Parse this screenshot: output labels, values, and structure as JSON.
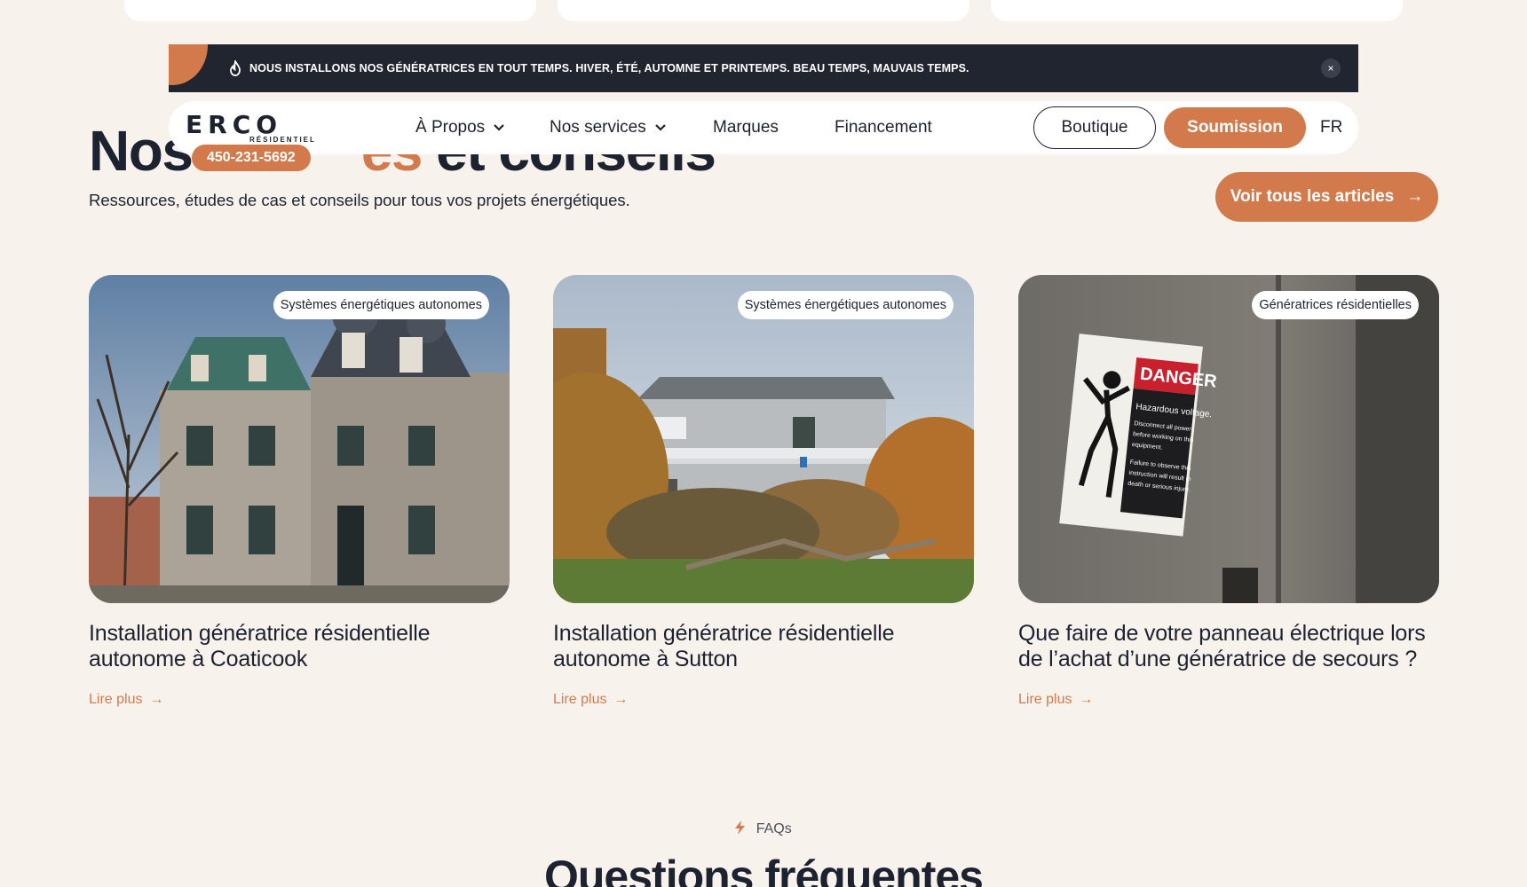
{
  "banner": {
    "text": "NOUS INSTALLONS NOS GÉNÉRATRICES EN TOUT TEMPS. HIVER, ÉTÉ, AUTOMNE ET PRINTEMPS. BEAU TEMPS, MAUVAIS TEMPS.",
    "icon": "flame-icon",
    "close_icon": "×"
  },
  "navbar": {
    "logo_main": "ERCO",
    "logo_sub": "RÉSIDENTIEL",
    "phone": "450-231-5692",
    "items": [
      {
        "label": "À Propos",
        "dropdown": true
      },
      {
        "label": "Nos services",
        "dropdown": true
      },
      {
        "label": "Marques",
        "dropdown": false
      },
      {
        "label": "Financement",
        "dropdown": false
      }
    ],
    "shop_label": "Boutique",
    "quote_label": "Soumission",
    "lang": "FR"
  },
  "section": {
    "title_start": "Nos ",
    "title_accent": "es",
    "title_end": " et conseils",
    "subtitle": "Ressources, études de cas et conseils pour tous vos projets énergétiques.",
    "view_all": "Voir tous les articles",
    "arrow": "→"
  },
  "articles": [
    {
      "tag": "Systèmes énergétiques autonomes",
      "title": "Installation génératrice résidentielle autonome à Coaticook",
      "read_more": "Lire plus"
    },
    {
      "tag": "Systèmes énergétiques autonomes",
      "title": "Installation génératrice résidentielle autonome à Sutton",
      "read_more": "Lire plus"
    },
    {
      "tag": "Génératrices résidentielles",
      "title": "Que faire de votre panneau électrique lors de l’achat d’une génératrice de secours ?",
      "read_more": "Lire plus",
      "image_text": {
        "danger": "DANGER",
        "hazard": "Hazardous voltage.",
        "lines": [
          "Disconnect all power",
          "before working on this",
          "equipment.",
          "Failure to observe this",
          "instruction will result in",
          "death or serious injury."
        ]
      }
    }
  ],
  "faq": {
    "label": "FAQs",
    "title": "Questions fréquentes"
  },
  "colors": {
    "accent": "#d37a4c",
    "dark": "#1c2230",
    "background": "#f8f2ec",
    "banner": "#20252f"
  }
}
